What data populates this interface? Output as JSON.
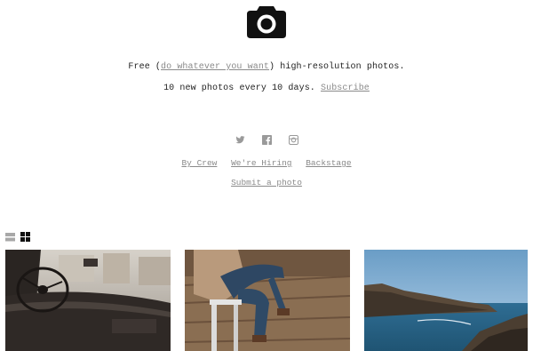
{
  "header": {
    "logo_icon": "camera-icon"
  },
  "tagline": {
    "prefix": "Free (",
    "link": "do whatever you want",
    "suffix": ") high-resolution photos."
  },
  "schedule": {
    "text": "10 new photos every 10 days.",
    "subscribe_label": "Subscribe"
  },
  "social": {
    "icons": [
      "twitter-icon",
      "facebook-icon",
      "instagram-icon"
    ]
  },
  "nav": {
    "by_crew": "By Crew",
    "hiring": "We're Hiring",
    "backstage": "Backstage",
    "submit": "Submit a photo"
  },
  "view_toggle": {
    "icons": [
      "list-view-icon",
      "grid-view-icon"
    ],
    "active": "grid"
  },
  "photos": [
    {
      "subject": "vintage car interior"
    },
    {
      "subject": "person sitting on stool"
    },
    {
      "subject": "rocky coastline"
    }
  ],
  "colors": {
    "text": "#222222",
    "link": "#8a8a8a",
    "icon_muted": "#9a9a9a",
    "logo": "#111111"
  }
}
